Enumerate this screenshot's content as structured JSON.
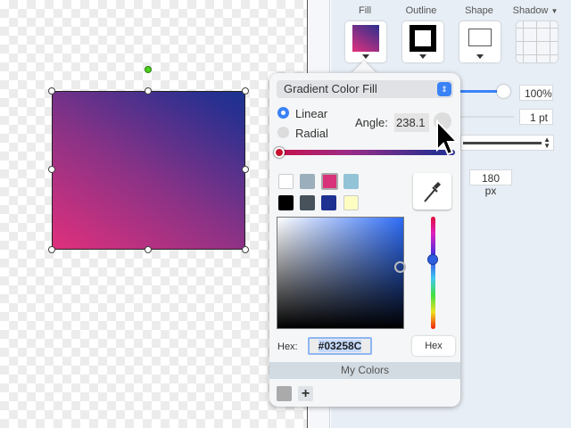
{
  "toolbar": {
    "fill": "Fill",
    "outline": "Outline",
    "shape": "Shape",
    "shadow": "Shadow"
  },
  "inspector": {
    "opacity": "100%",
    "stroke": "1 pt",
    "size": "180 px"
  },
  "popover": {
    "fill_type": "Gradient Color Fill",
    "linear": "Linear",
    "radial": "Radial",
    "angle_label": "Angle:",
    "angle_value": "238.1",
    "hex_label": "Hex:",
    "hex_value": "#03258C",
    "hex_button": "Hex",
    "my_colors": "My Colors"
  },
  "swatches": [
    "#ffffff",
    "#9aaebb",
    "#d8327a",
    "#92c3d6",
    "#000000",
    "#47525b",
    "#1c3190",
    "#fdfdc2"
  ],
  "colors": {
    "gradient_start": "#e0307c",
    "gradient_end": "#1c3290",
    "accent": "#3a82f6"
  }
}
